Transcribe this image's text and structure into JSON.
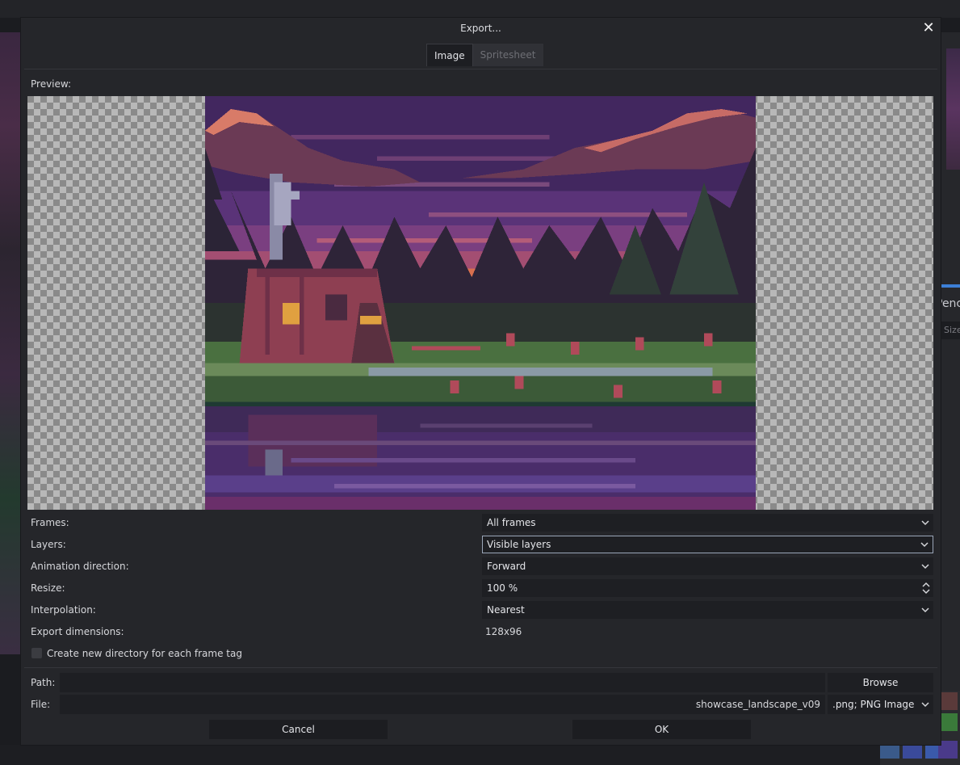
{
  "dialog": {
    "title": "Export...",
    "close_glyph": "✕",
    "tabs": [
      {
        "label": "Image",
        "active": true
      },
      {
        "label": "Spritesheet",
        "active": false
      }
    ],
    "preview_label": "Preview:"
  },
  "options": {
    "frames_label": "Frames:",
    "frames_value": "All frames",
    "layers_label": "Layers:",
    "layers_value": "Visible layers",
    "direction_label": "Animation direction:",
    "direction_value": "Forward",
    "resize_label": "Resize:",
    "resize_value": "100 %",
    "interpolation_label": "Interpolation:",
    "interpolation_value": "Nearest",
    "dimensions_label": "Export dimensions:",
    "dimensions_value": "128x96",
    "new_dir_label": "Create new directory for each frame tag",
    "new_dir_checked": false
  },
  "path": {
    "label": "Path:",
    "value": "",
    "browse_label": "Browse"
  },
  "file": {
    "label": "File:",
    "value": "showcase_landscape_v09",
    "format_value": ".png; PNG Image"
  },
  "actions": {
    "cancel_label": "Cancel",
    "ok_label": "OK"
  },
  "background": {
    "right_panel_text": "Penc",
    "right_panel_input": "Size"
  },
  "colors": {
    "dialog_bg": "#25262a",
    "field_bg": "#1e1f23",
    "accent": "#3d7fd6"
  }
}
